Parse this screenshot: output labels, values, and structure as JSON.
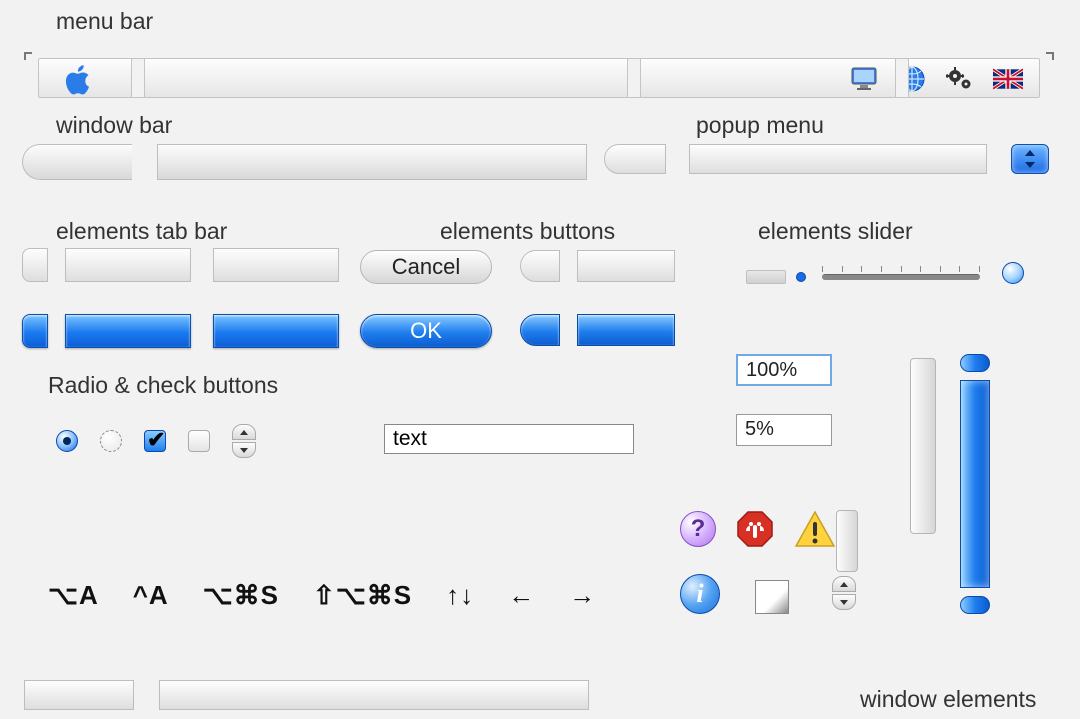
{
  "labels": {
    "menu_bar": "menu bar",
    "window_bar": "window bar",
    "popup_menu": "popup menu",
    "elements_tab_bar": "elements tab bar",
    "elements_buttons": "elements buttons",
    "elements_slider": "elements slider",
    "radio_check": "Radio & check buttons",
    "window_elements": "window elements"
  },
  "buttons": {
    "cancel": "Cancel",
    "ok": "OK"
  },
  "fields": {
    "text_input": "text",
    "pct_100": "100%",
    "pct_5": "5%"
  },
  "shortcuts": {
    "s1": "⌥A",
    "s2": "^A",
    "s3": "⌥⌘S",
    "s4": "⇧⌥⌘S",
    "s5": "↑↓",
    "s6": "←",
    "s7": "→"
  },
  "menu_icons": [
    "monitor-icon",
    "globe-icon",
    "gears-icon",
    "flag-uk-icon"
  ],
  "alert_icons": [
    "help-icon",
    "stop-icon",
    "warning-icon",
    "info-icon"
  ]
}
